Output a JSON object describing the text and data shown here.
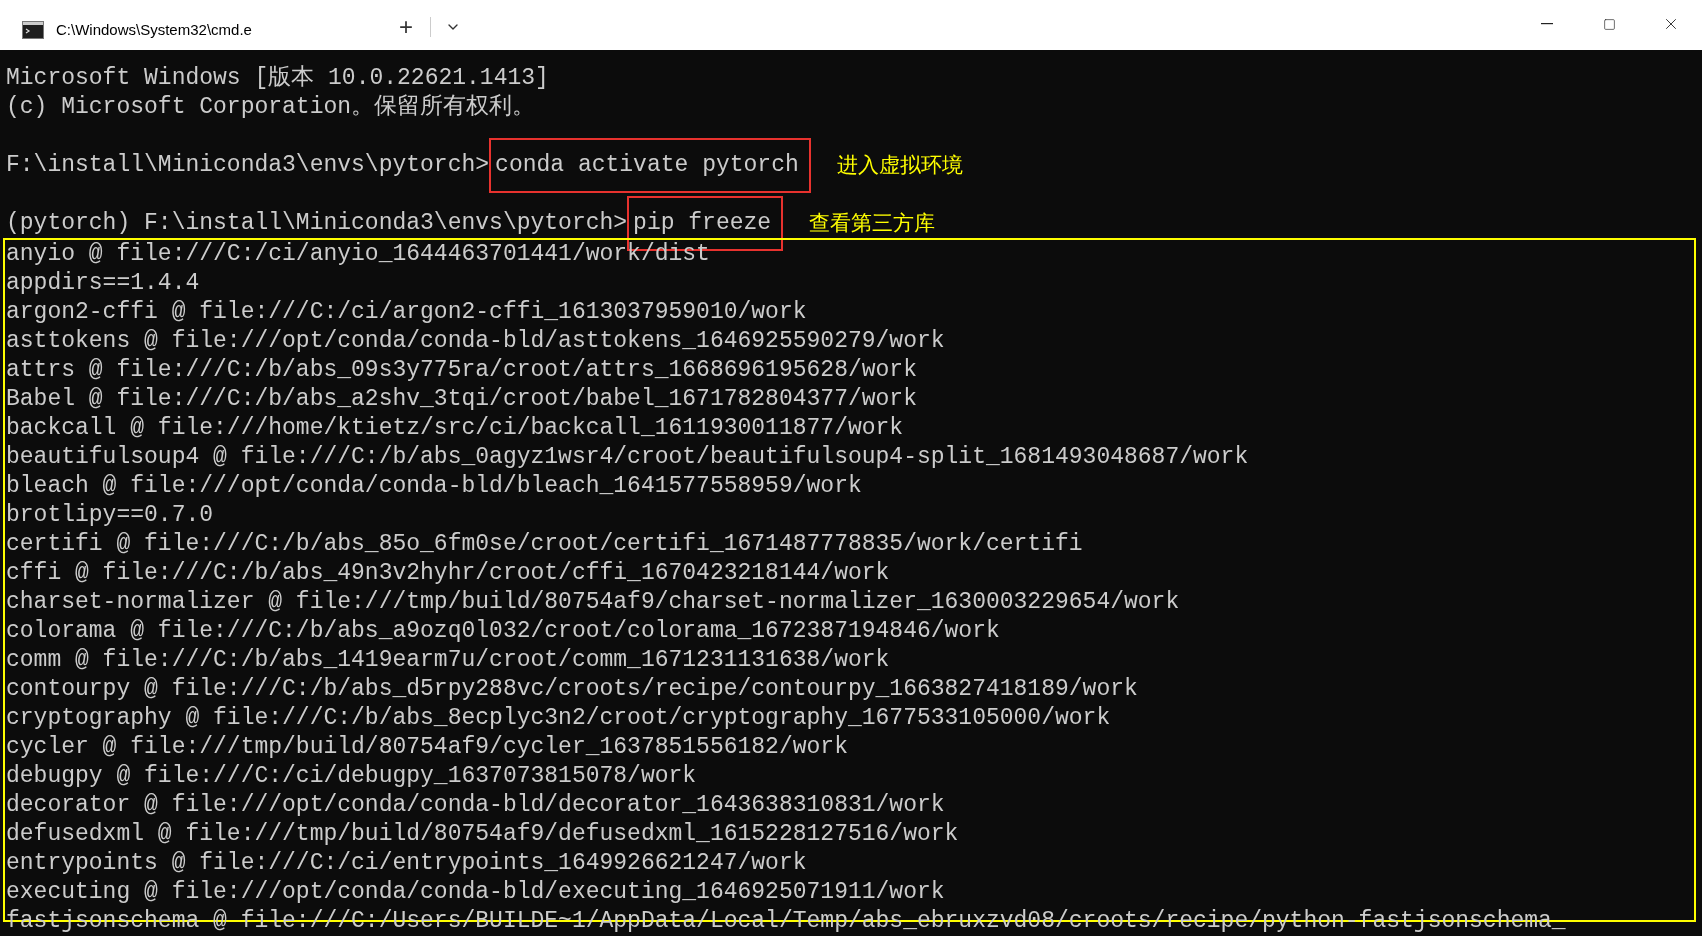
{
  "window": {
    "tab_title": "C:\\Windows\\System32\\cmd.e",
    "new_tab": "+"
  },
  "terminal": {
    "lines": [
      {
        "kind": "text",
        "text": "Microsoft Windows [版本 10.0.22621.1413]"
      },
      {
        "kind": "text",
        "text": "(c) Microsoft Corporation。保留所有权利。"
      },
      {
        "kind": "blank"
      },
      {
        "kind": "command",
        "prompt": "F:\\install\\Miniconda3\\envs\\pytorch>",
        "command": "conda activate pytorch",
        "note": "进入虚拟环境"
      },
      {
        "kind": "blank"
      },
      {
        "kind": "command",
        "prompt": "(pytorch) F:\\install\\Miniconda3\\envs\\pytorch>",
        "command": "pip freeze",
        "note": "查看第三方库"
      }
    ],
    "output": [
      "anyio @ file:///C:/ci/anyio_1644463701441/work/dist",
      "appdirs==1.4.4",
      "argon2-cffi @ file:///C:/ci/argon2-cffi_1613037959010/work",
      "asttokens @ file:///opt/conda/conda-bld/asttokens_1646925590279/work",
      "attrs @ file:///C:/b/abs_09s3y775ra/croot/attrs_1668696195628/work",
      "Babel @ file:///C:/b/abs_a2shv_3tqi/croot/babel_1671782804377/work",
      "backcall @ file:///home/ktietz/src/ci/backcall_1611930011877/work",
      "beautifulsoup4 @ file:///C:/b/abs_0agyz1wsr4/croot/beautifulsoup4-split_1681493048687/work",
      "bleach @ file:///opt/conda/conda-bld/bleach_1641577558959/work",
      "brotlipy==0.7.0",
      "certifi @ file:///C:/b/abs_85o_6fm0se/croot/certifi_1671487778835/work/certifi",
      "cffi @ file:///C:/b/abs_49n3v2hyhr/croot/cffi_1670423218144/work",
      "charset-normalizer @ file:///tmp/build/80754af9/charset-normalizer_1630003229654/work",
      "colorama @ file:///C:/b/abs_a9ozq0l032/croot/colorama_1672387194846/work",
      "comm @ file:///C:/b/abs_1419earm7u/croot/comm_1671231131638/work",
      "contourpy @ file:///C:/b/abs_d5rpy288vc/croots/recipe/contourpy_1663827418189/work",
      "cryptography @ file:///C:/b/abs_8ecplyc3n2/croot/cryptography_1677533105000/work",
      "cycler @ file:///tmp/build/80754af9/cycler_1637851556182/work",
      "debugpy @ file:///C:/ci/debugpy_1637073815078/work",
      "decorator @ file:///opt/conda/conda-bld/decorator_1643638310831/work",
      "defusedxml @ file:///tmp/build/80754af9/defusedxml_1615228127516/work",
      "entrypoints @ file:///C:/ci/entrypoints_1649926621247/work",
      "executing @ file:///opt/conda/conda-bld/executing_1646925071911/work",
      "fastjsonschema @ file:///C:/Users/BUILDE~1/AppData/Local/Temp/abs_ebruxzvd08/croots/recipe/python-fastjsonschema_"
    ]
  }
}
